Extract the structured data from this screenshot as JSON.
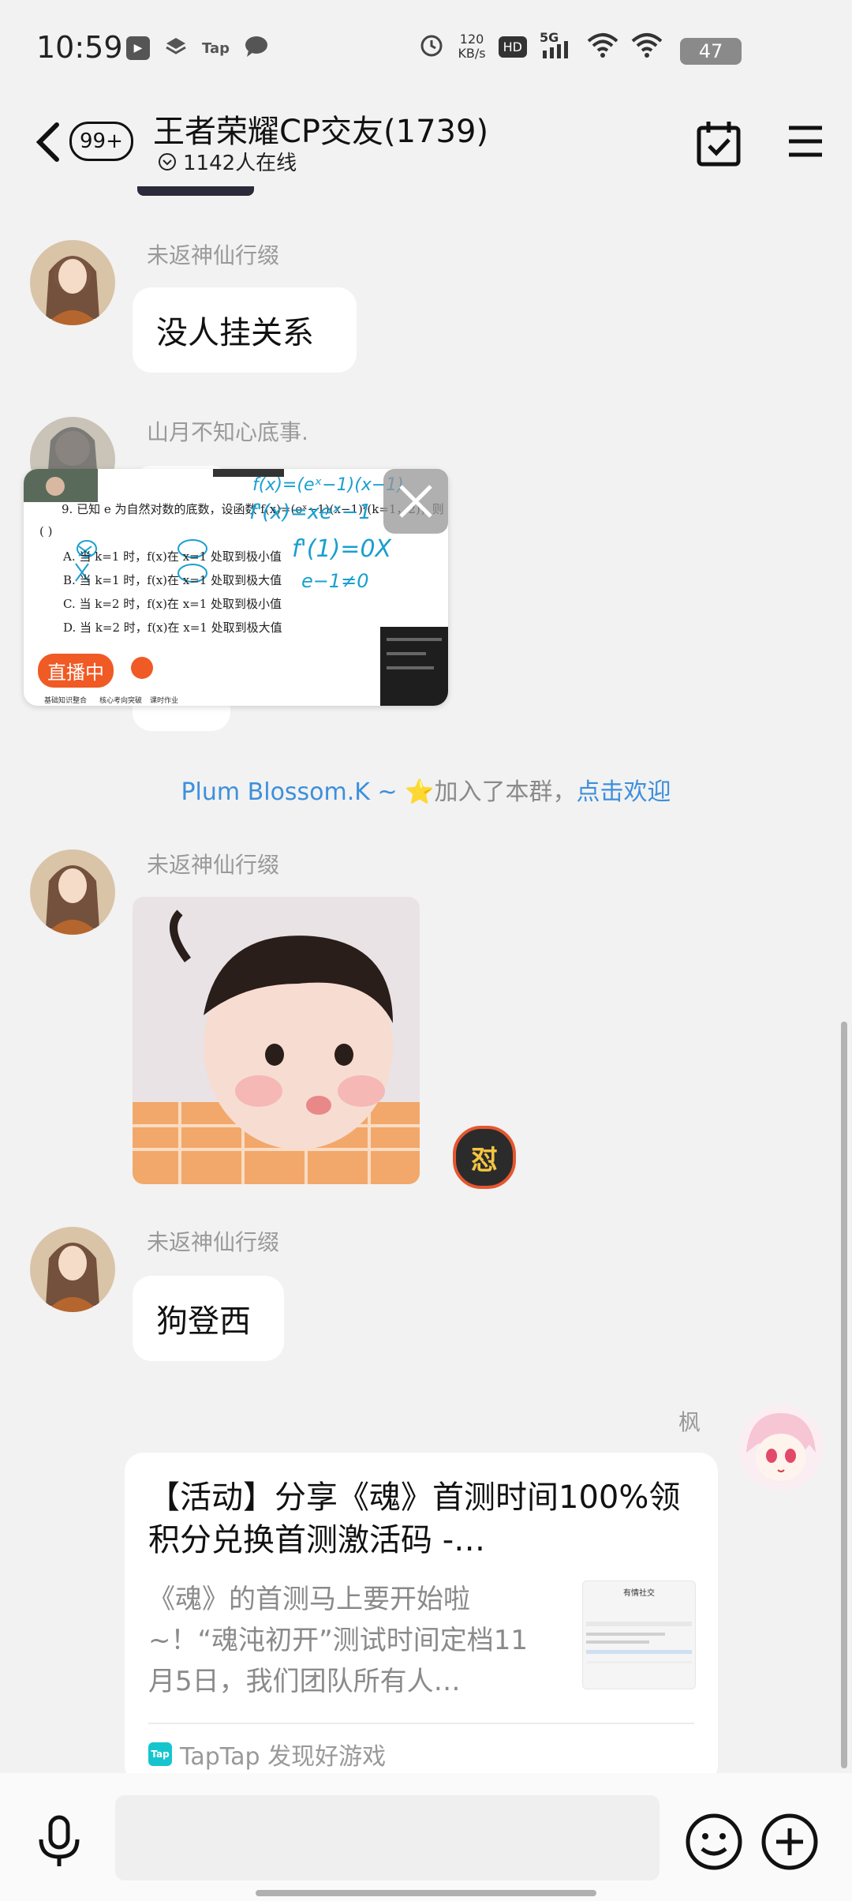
{
  "status_bar": {
    "time": "10:59",
    "app_icons": [
      "notification-icon",
      "layers-icon",
      "Tap",
      "chat-bubble-icon"
    ],
    "net_speed_value": "120",
    "net_speed_unit": "KB/s",
    "hd": "HD",
    "signal": "5G",
    "battery": "47"
  },
  "header": {
    "unread_badge": "99+",
    "title": "王者荣耀CP交友(1739)",
    "online": "1142人在线"
  },
  "messages": [
    {
      "sender": "未返神仙行缀",
      "text": "没人挂关系"
    },
    {
      "sender": "山月不知心底事."
    },
    {
      "sender": "未返神仙行缀",
      "sticker_badge": "怼"
    },
    {
      "sender": "未返神仙行缀",
      "text": "狗登西"
    },
    {
      "sender": "枫"
    }
  ],
  "system_message": {
    "name": "Plum Blossom.K ~ ⭐",
    "action": "加入了本群，",
    "link": "点击欢迎"
  },
  "live_overlay": {
    "badge": "直播中",
    "question_lines": [
      "9. 已知 e 为自然对数的底数，设函数 f(x)=(eˣ−1)(x−1)ᵏ(k=1，2)，则",
      "(    )",
      "A. 当 k=1 时，f(x)在 x=1 处取到极小值",
      "B. 当 k=1 时，f(x)在 x=1 处取到极大值",
      "C. 当 k=2 时，f(x)在 x=1 处取到极小值",
      "D. 当 k=2 时，f(x)在 x=1 处取到极大值"
    ],
    "handwriting": [
      "f(x)=(eˣ−1)(x−1)",
      "f'(x)=xeˣ−1",
      "f'(1)=0X",
      "e−1≠0"
    ],
    "bottom_tabs": [
      "基础知识整合",
      "核心考向突破",
      "课时作业"
    ]
  },
  "share_card": {
    "title": "【活动】分享《魂》首测时间100%领积分兑换首测激活码 -…",
    "description": "《魂》的首测马上要开始啦~！“魂沌初开”测试时间定档11月5日，我们团队所有人…",
    "thumb_heading": "有情社交",
    "source_logo": "Tap",
    "source": "TapTap 发现好游戏"
  },
  "input": {
    "placeholder": ""
  },
  "colors": {
    "background": "#f2f2f2",
    "link": "#3d8fdc",
    "live_badge": "#f05a24",
    "taptap": "#15c5ce"
  }
}
